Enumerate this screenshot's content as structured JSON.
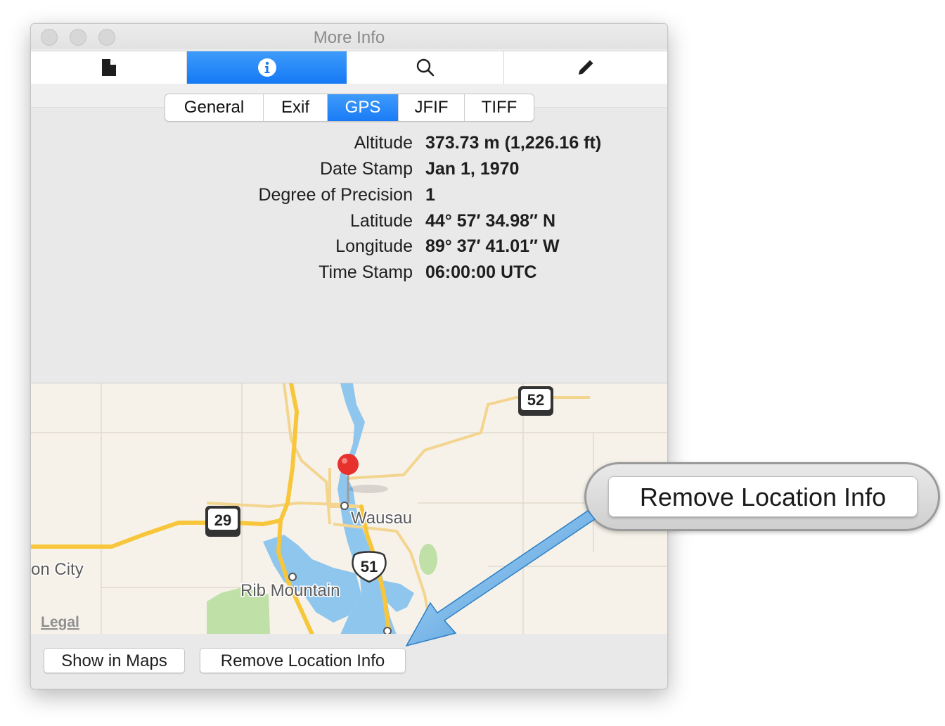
{
  "window": {
    "title": "More Info"
  },
  "toolbar": {
    "tabs": [
      {
        "icon": "document-icon"
      },
      {
        "icon": "info-icon",
        "active": true
      },
      {
        "icon": "magnifier-icon"
      },
      {
        "icon": "pencil-icon"
      }
    ]
  },
  "segments": {
    "items": [
      "General",
      "Exif",
      "GPS",
      "JFIF",
      "TIFF"
    ],
    "selected": "GPS"
  },
  "gps": {
    "rows": [
      {
        "label": "Altitude",
        "value": "373.73 m (1,226.16 ft)"
      },
      {
        "label": "Date Stamp",
        "value": "Jan 1, 1970"
      },
      {
        "label": "Degree of Precision",
        "value": "1"
      },
      {
        "label": "Latitude",
        "value": "44° 57′ 34.98″ N"
      },
      {
        "label": "Longitude",
        "value": "89° 37′ 41.01″ W"
      },
      {
        "label": "Time Stamp",
        "value": "06:00:00 UTC"
      }
    ]
  },
  "map": {
    "place_main": "Wausau",
    "place_secondary": "Rib Mountain",
    "place_edge": "on City",
    "legal": "Legal",
    "shields": [
      "52",
      "29",
      "51"
    ]
  },
  "buttons": {
    "show_in_maps": "Show in Maps",
    "remove_location": "Remove Location Info"
  },
  "callout": {
    "label": "Remove Location Info"
  },
  "colors": {
    "accent": "#1a7cf5",
    "pin": "#e8312c",
    "water": "#8fc6ee",
    "highway": "#f8c63a",
    "park": "#bfe0a7",
    "arrow": "#3a90d6"
  }
}
